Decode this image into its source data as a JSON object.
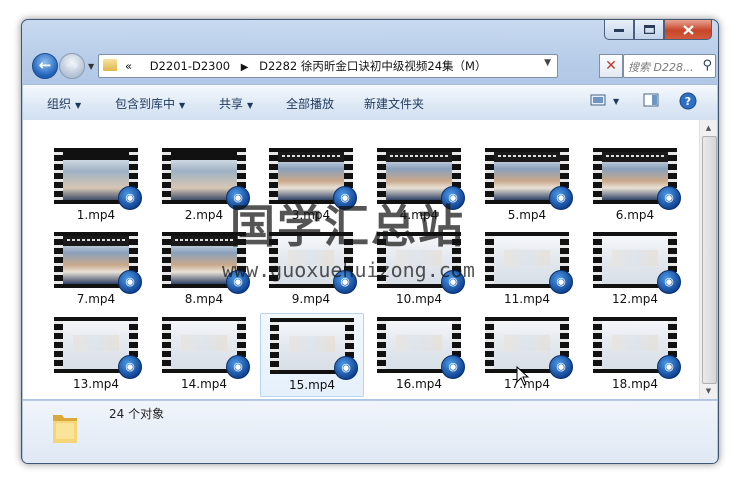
{
  "address": {
    "crumbs": [
      "D2201-D2300",
      "D2282 徐丙昕金口诀初中级视频24集（M）"
    ],
    "recent_glyph": "«"
  },
  "search": {
    "placeholder": "搜索 D228..."
  },
  "toolbar": {
    "organize": "组织",
    "include_in_library": "包含到库中",
    "share": "共享",
    "play_all": "全部播放",
    "new_folder": "新建文件夹"
  },
  "files": [
    {
      "name": "1.mp4",
      "thumb": "dark"
    },
    {
      "name": "2.mp4",
      "thumb": "dark"
    },
    {
      "name": "3.mp4",
      "thumb": "txt"
    },
    {
      "name": "4.mp4",
      "thumb": "txt"
    },
    {
      "name": "5.mp4",
      "thumb": "txt"
    },
    {
      "name": "6.mp4",
      "thumb": "txt"
    },
    {
      "name": "7.mp4",
      "thumb": "txt"
    },
    {
      "name": "8.mp4",
      "thumb": "txt"
    },
    {
      "name": "9.mp4",
      "thumb": "pale"
    },
    {
      "name": "10.mp4",
      "thumb": "pale"
    },
    {
      "name": "11.mp4",
      "thumb": "pale"
    },
    {
      "name": "12.mp4",
      "thumb": "pale"
    },
    {
      "name": "13.mp4",
      "thumb": "pale"
    },
    {
      "name": "14.mp4",
      "thumb": "pale"
    },
    {
      "name": "15.mp4",
      "thumb": "pale",
      "selected": true
    },
    {
      "name": "16.mp4",
      "thumb": "pale"
    },
    {
      "name": "17.mp4",
      "thumb": "pale"
    },
    {
      "name": "18.mp4",
      "thumb": "pale"
    }
  ],
  "watermark": {
    "title": "国学汇总站",
    "url": "www.guoxuehuizong.com"
  },
  "status": {
    "count": "24 个对象"
  }
}
